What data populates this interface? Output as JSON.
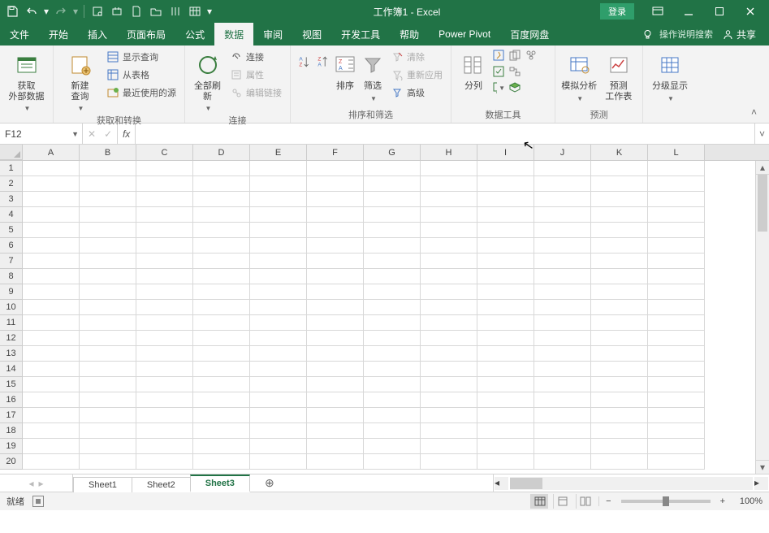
{
  "title": "工作簿1 - Excel",
  "login": "登录",
  "tabs": [
    "文件",
    "开始",
    "插入",
    "页面布局",
    "公式",
    "数据",
    "审阅",
    "视图",
    "开发工具",
    "帮助",
    "Power Pivot",
    "百度网盘"
  ],
  "active_tab_index": 5,
  "tell_me": "操作说明搜索",
  "share": "共享",
  "groups": {
    "g1": {
      "btn": "获取\n外部数据",
      "label": ""
    },
    "g2": {
      "btn": "新建\n查询",
      "i1": "显示查询",
      "i2": "从表格",
      "i3": "最近使用的源",
      "label": "获取和转换"
    },
    "g3": {
      "btn": "全部刷新",
      "i1": "连接",
      "i2": "属性",
      "i3": "编辑链接",
      "label": "连接"
    },
    "g4": {
      "btn2": "排序",
      "btn3": "筛选",
      "i1": "清除",
      "i2": "重新应用",
      "i3": "高级",
      "label": "排序和筛选"
    },
    "g5": {
      "btn": "分列",
      "label": "数据工具"
    },
    "g6": {
      "btn1": "模拟分析",
      "btn2": "预测\n工作表",
      "label": "预测"
    },
    "g7": {
      "btn": "分级显示",
      "label": ""
    }
  },
  "name_box": "F12",
  "formula": "",
  "columns": [
    "A",
    "B",
    "C",
    "D",
    "E",
    "F",
    "G",
    "H",
    "I",
    "J",
    "K",
    "L"
  ],
  "rows": [
    "1",
    "2",
    "3",
    "4",
    "5",
    "6",
    "7",
    "8",
    "9",
    "10",
    "11",
    "12",
    "13",
    "14",
    "15",
    "16",
    "17",
    "18",
    "19",
    "20"
  ],
  "sheets": [
    "Sheet1",
    "Sheet2",
    "Sheet3"
  ],
  "active_sheet_index": 2,
  "status_ready": "就绪",
  "zoom": "100%"
}
